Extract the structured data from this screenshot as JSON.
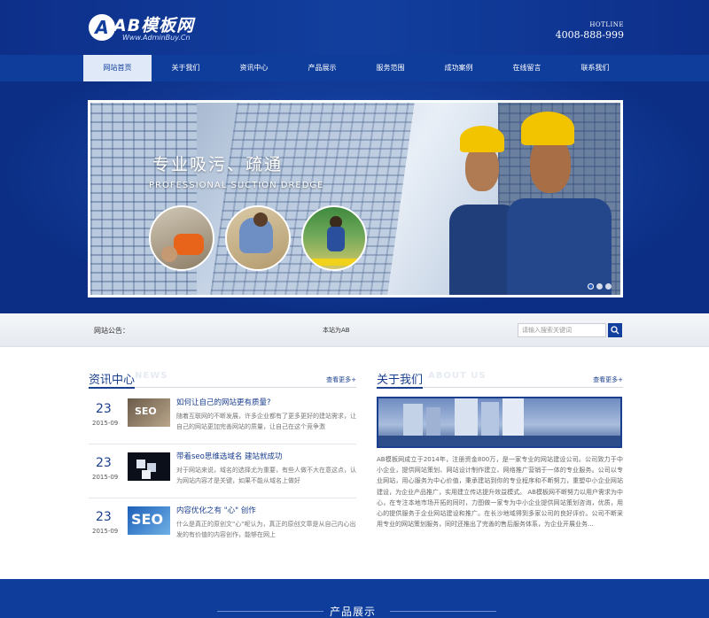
{
  "header": {
    "logo_mark": "A",
    "logo_title": "AB模板网",
    "logo_sub": "Www.AdminBuy.Cn",
    "hotline_label": "HOTLINE",
    "hotline_number": "4008-888-999"
  },
  "nav": {
    "items": [
      "网站首页",
      "关于我们",
      "资讯中心",
      "产品展示",
      "服务范围",
      "成功案例",
      "在线留言",
      "联系我们"
    ]
  },
  "banner": {
    "title": "专业吸污、疏通",
    "subtitle": "PROFESSIONAL SUCTION DREDGE"
  },
  "notice": {
    "label": "网站公告：",
    "text": "本站为AB",
    "search_placeholder": "请输入搜索关键词"
  },
  "news": {
    "title": "资讯中心",
    "ghost": "NEWS",
    "more": "查看更多+",
    "items": [
      {
        "day": "23",
        "ym": "2015-09",
        "title": "如何让自己的网站更有质量?",
        "desc": "随着互联网的不断发展，许多企业都有了更多更好的建站需求，让自己的网站更加完善网站的质量，让自己在这个竞争激"
      },
      {
        "day": "23",
        "ym": "2015-09",
        "title": "带着seo思维选域名  建站就成功",
        "desc": "对于网站来说，域名的选择尤为重要，有些人做不大在意这点，认为网站内容才是关键，如果不能从域名上做好"
      },
      {
        "day": "23",
        "ym": "2015-09",
        "title": "内容优化之有 \"心\" 创作",
        "desc": "什么是真正的原创文\"心\"呢认为，真正的原创文章是从自己内心出发的有价值的内容创作，能够在网上"
      }
    ]
  },
  "about": {
    "title": "关于我们",
    "ghost": "ABOUT US",
    "more": "查看更多+",
    "text": "AB模板网成立于2014年，注册资金800万，是一家专业的网站建设公司。公司致力于中小企业，提供网站策划、网站设计制作建立、网络推广营销于一体的专业服务。公司以专业网站，用心服务为中心价值，秉承建站到你的专业程序和不断努力，重塑中小企业网站建设，为企业产品推广，实用建立传达提升效益模式。  AB模板网不断努力以用户需求为中心，在专注本地市场开拓的同时，力图做一家专为中小企业提供网站策划咨询，优质，用心的提供服务于企业网站建设和推广。在长沙地域得到多家公司的良好评价。公司不断采用专业的网站策划服务，同时还推出了完善的售后服务体系，为企业开展业务..."
  },
  "products": {
    "title": "产品展示"
  },
  "colors": {
    "primary": "#0f3d9c",
    "accent": "#1a3f8f",
    "helmet": "#f2c400"
  }
}
